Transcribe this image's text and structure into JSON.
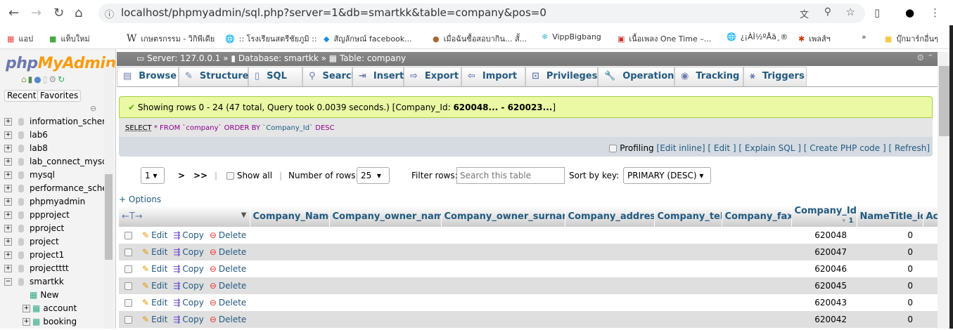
{
  "browser": {
    "url": "localhost/phpmyadmin/sql.php?server=1&db=smartkk&table=company&pos=0",
    "bookmarks": [
      "แอป",
      "แท็บใหม่",
      "เกษตรกรรม - วิกิพีเดีย",
      ":: โรงเรียนสตรีชัยภูมิ ::",
      "สัญลักษณ์ facebook...",
      "เมื่อฉันซื้อสอบากิน... สั้...",
      "VippBigbang",
      "เนื้อเพลง One Time –...",
      "¿¡ÀÌ½ºÅä¸®",
      "เพลส์ฯ",
      "»",
      "บุ๊กมาร์กอื่นๆ"
    ]
  },
  "sidebar": {
    "logo_a": "php",
    "logo_b": "MyAdmin",
    "recent": "Recent",
    "favorites": "Favorites",
    "databases": [
      "information_schema",
      "lab6",
      "lab8",
      "lab_connect_mysql",
      "mysql",
      "performance_schema",
      "phpmyadmin",
      "ppproject",
      "pproject",
      "project",
      "project1",
      "projectttt",
      "smartkk"
    ],
    "smartkk_children": [
      "New",
      "account",
      "booking"
    ]
  },
  "breadcrumb": {
    "server": "Server: 127.0.0.1",
    "database": "Database: smartkk",
    "table": "Table: company"
  },
  "tabs": [
    "Browse",
    "Structure",
    "SQL",
    "Search",
    "Insert",
    "Export",
    "Import",
    "Privileges",
    "Operations",
    "Tracking",
    "Triggers"
  ],
  "message": {
    "text": "Showing rows 0 - 24 (47 total, Query took 0.0039 seconds.) [Company_Id: ",
    "from": "620048...",
    "sep": " - ",
    "to": "620023...",
    "end": "]"
  },
  "sql": {
    "select": "SELECT",
    "rest": " * FROM `company` ORDER BY ",
    "col": "`Company_Id`",
    "desc": " DESC"
  },
  "profiling": {
    "label": "Profiling",
    "links": [
      "[Edit inline]",
      "[ Edit ]",
      "[ Explain SQL ]",
      "[ Create PHP code ]",
      "[ Refresh]"
    ]
  },
  "controls": {
    "page": "1",
    "next": ">",
    "last": ">>",
    "show_all": "Show all",
    "num_rows_label": "Number of rows:",
    "num_rows": "25",
    "filter_label": "Filter rows:",
    "filter_placeholder": "Search this table",
    "sort_label": "Sort by key:",
    "sort_value": "PRIMARY (DESC)"
  },
  "options": "+ Options",
  "table": {
    "columns": [
      "Company_Name",
      "Company_owner_name",
      "Company_owner_surname",
      "Company_address",
      "Company_tel",
      "Company_fax",
      "Company_Id",
      "NameTitle_id",
      "Ac"
    ],
    "sort_indicator": "1",
    "edit": "Edit",
    "copy": "Copy",
    "delete": "Delete",
    "rows": [
      {
        "id": "620048",
        "title": "0"
      },
      {
        "id": "620047",
        "title": "0"
      },
      {
        "id": "620046",
        "title": "0"
      },
      {
        "id": "620045",
        "title": "0"
      },
      {
        "id": "620043",
        "title": "0"
      },
      {
        "id": "620042",
        "title": "0"
      }
    ]
  }
}
